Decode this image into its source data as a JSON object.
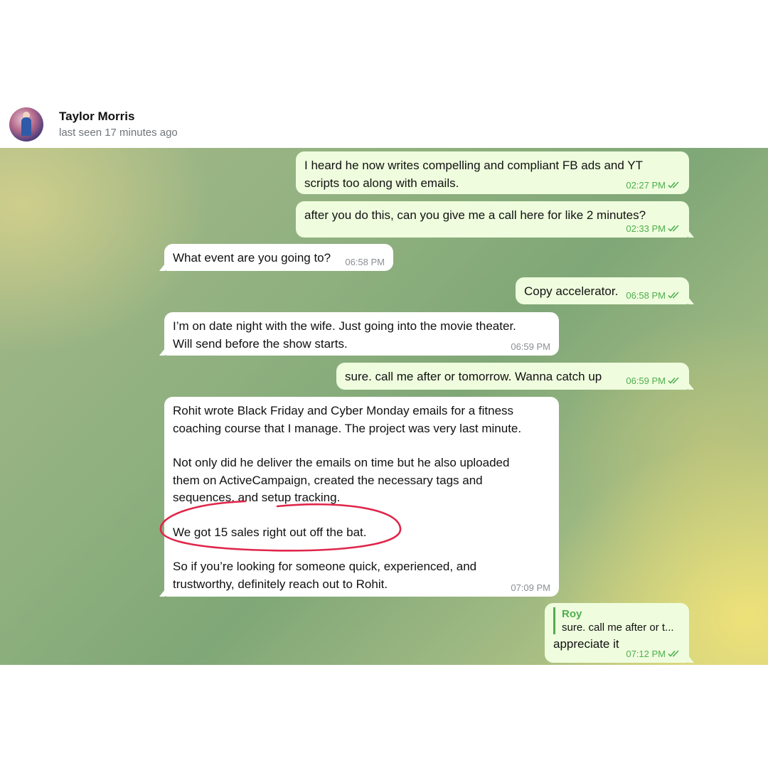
{
  "contact": {
    "name": "Taylor Morris",
    "status": "last seen 17 minutes ago",
    "avatar_icon": "avatar-photo"
  },
  "colors": {
    "outgoing_bubble": "#effdde",
    "incoming_bubble": "#ffffff",
    "accent_green": "#4fae4e",
    "highlight_circle": "#e0264a"
  },
  "messages": [
    {
      "dir": "out",
      "lines": [
        "I heard he now writes compelling and compliant FB ads and YT",
        "scripts too along with emails."
      ],
      "time": "02:27 PM",
      "read": true
    },
    {
      "dir": "out",
      "lines": [
        "after you do this, can you give me a call here for like 2 minutes?"
      ],
      "time": "02:33 PM",
      "read": true
    },
    {
      "dir": "in",
      "lines": [
        "What event are you going to?"
      ],
      "time": "06:58 PM"
    },
    {
      "dir": "out",
      "lines": [
        "Copy accelerator."
      ],
      "time": "06:58 PM",
      "read": true
    },
    {
      "dir": "in",
      "lines": [
        "I’m on date night with the wife. Just going into the movie theater.",
        "Will send before the show starts."
      ],
      "time": "06:59 PM"
    },
    {
      "dir": "out",
      "lines": [
        "sure. call me after or tomorrow. Wanna catch up"
      ],
      "time": "06:59 PM",
      "read": true
    },
    {
      "dir": "in",
      "paragraphs": [
        "Rohit wrote Black Friday and Cyber Monday emails for a fitness",
        "coaching course that I manage. The project was very last minute.",
        "",
        "Not only did he deliver the emails on time but he also uploaded",
        "them on ActiveCampaign, created the necessary tags and",
        "sequences, and setup tracking.",
        "",
        "We got 15 sales right out off the bat.",
        "",
        "So if you’re looking for someone quick, experienced, and",
        "trustworthy, definitely reach out to Rohit."
      ],
      "time": "07:09 PM"
    },
    {
      "dir": "out",
      "reply": {
        "author": "Roy",
        "snippet": "sure. call me after or t..."
      },
      "lines": [
        "appreciate it"
      ],
      "time": "07:12 PM",
      "read": true
    }
  ]
}
